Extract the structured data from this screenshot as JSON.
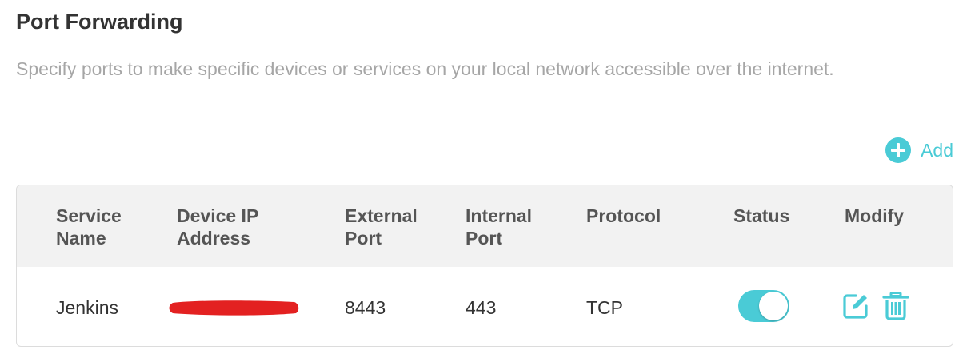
{
  "header": {
    "title": "Port Forwarding",
    "description": "Specify ports to make specific devices or services on your local network accessible over the internet."
  },
  "toolbar": {
    "add_label": "Add",
    "add_icon": "plus-circle-icon"
  },
  "colors": {
    "accent": "#4acbd6",
    "redaction": "#e32121"
  },
  "table": {
    "columns": [
      {
        "line1": "Service",
        "line2": "Name"
      },
      {
        "line1": "Device IP",
        "line2": "Address"
      },
      {
        "line1": "External",
        "line2": "Port"
      },
      {
        "line1": "Internal",
        "line2": "Port"
      },
      {
        "line1": "Protocol",
        "line2": ""
      },
      {
        "line1": "Status",
        "line2": ""
      },
      {
        "line1": "Modify",
        "line2": ""
      }
    ],
    "rows": [
      {
        "service_name": "Jenkins",
        "external_port": "8443",
        "internal_port": "443",
        "protocol": "TCP",
        "status_enabled": true,
        "edit_icon": "edit-icon",
        "delete_icon": "trash-icon"
      }
    ]
  }
}
